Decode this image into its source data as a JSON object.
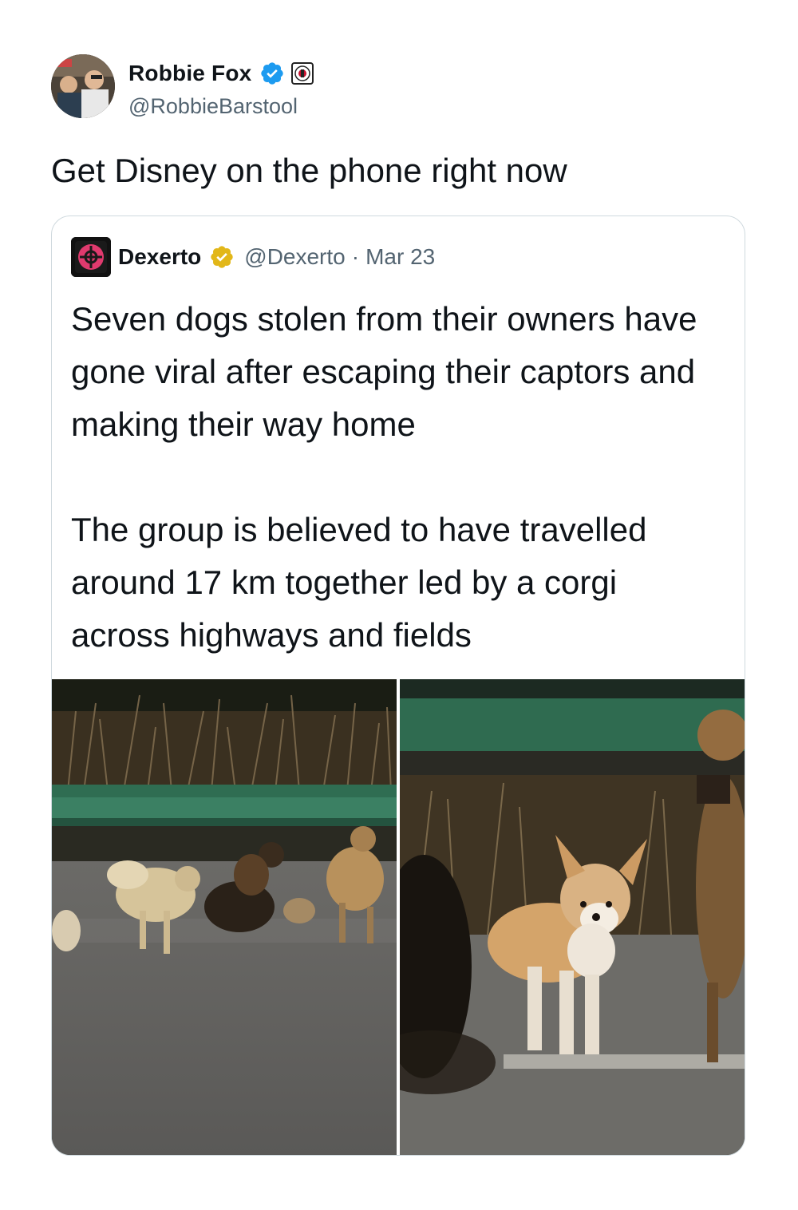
{
  "author": {
    "display_name": "Robbie Fox",
    "handle": "@RobbieBarstool",
    "verified_icon": "verified-badge-icon",
    "affiliation_icon": "barstool-affiliate-icon",
    "verified_color": "#1d9bf0"
  },
  "tweet": {
    "text": "Get Disney on the phone right now"
  },
  "quoted": {
    "display_name": "Dexerto",
    "handle": "@Dexerto",
    "separator": "·",
    "date": "Mar 23",
    "badge_icon": "gold-verified-badge-icon",
    "badge_color": "#e2b719",
    "paragraph_1": "Seven dogs stolen from their owners have gone viral after escaping their captors and making their way home",
    "paragraph_2": "The group is believed to have travelled around 17 km together led by a corgi across highways and fields"
  }
}
